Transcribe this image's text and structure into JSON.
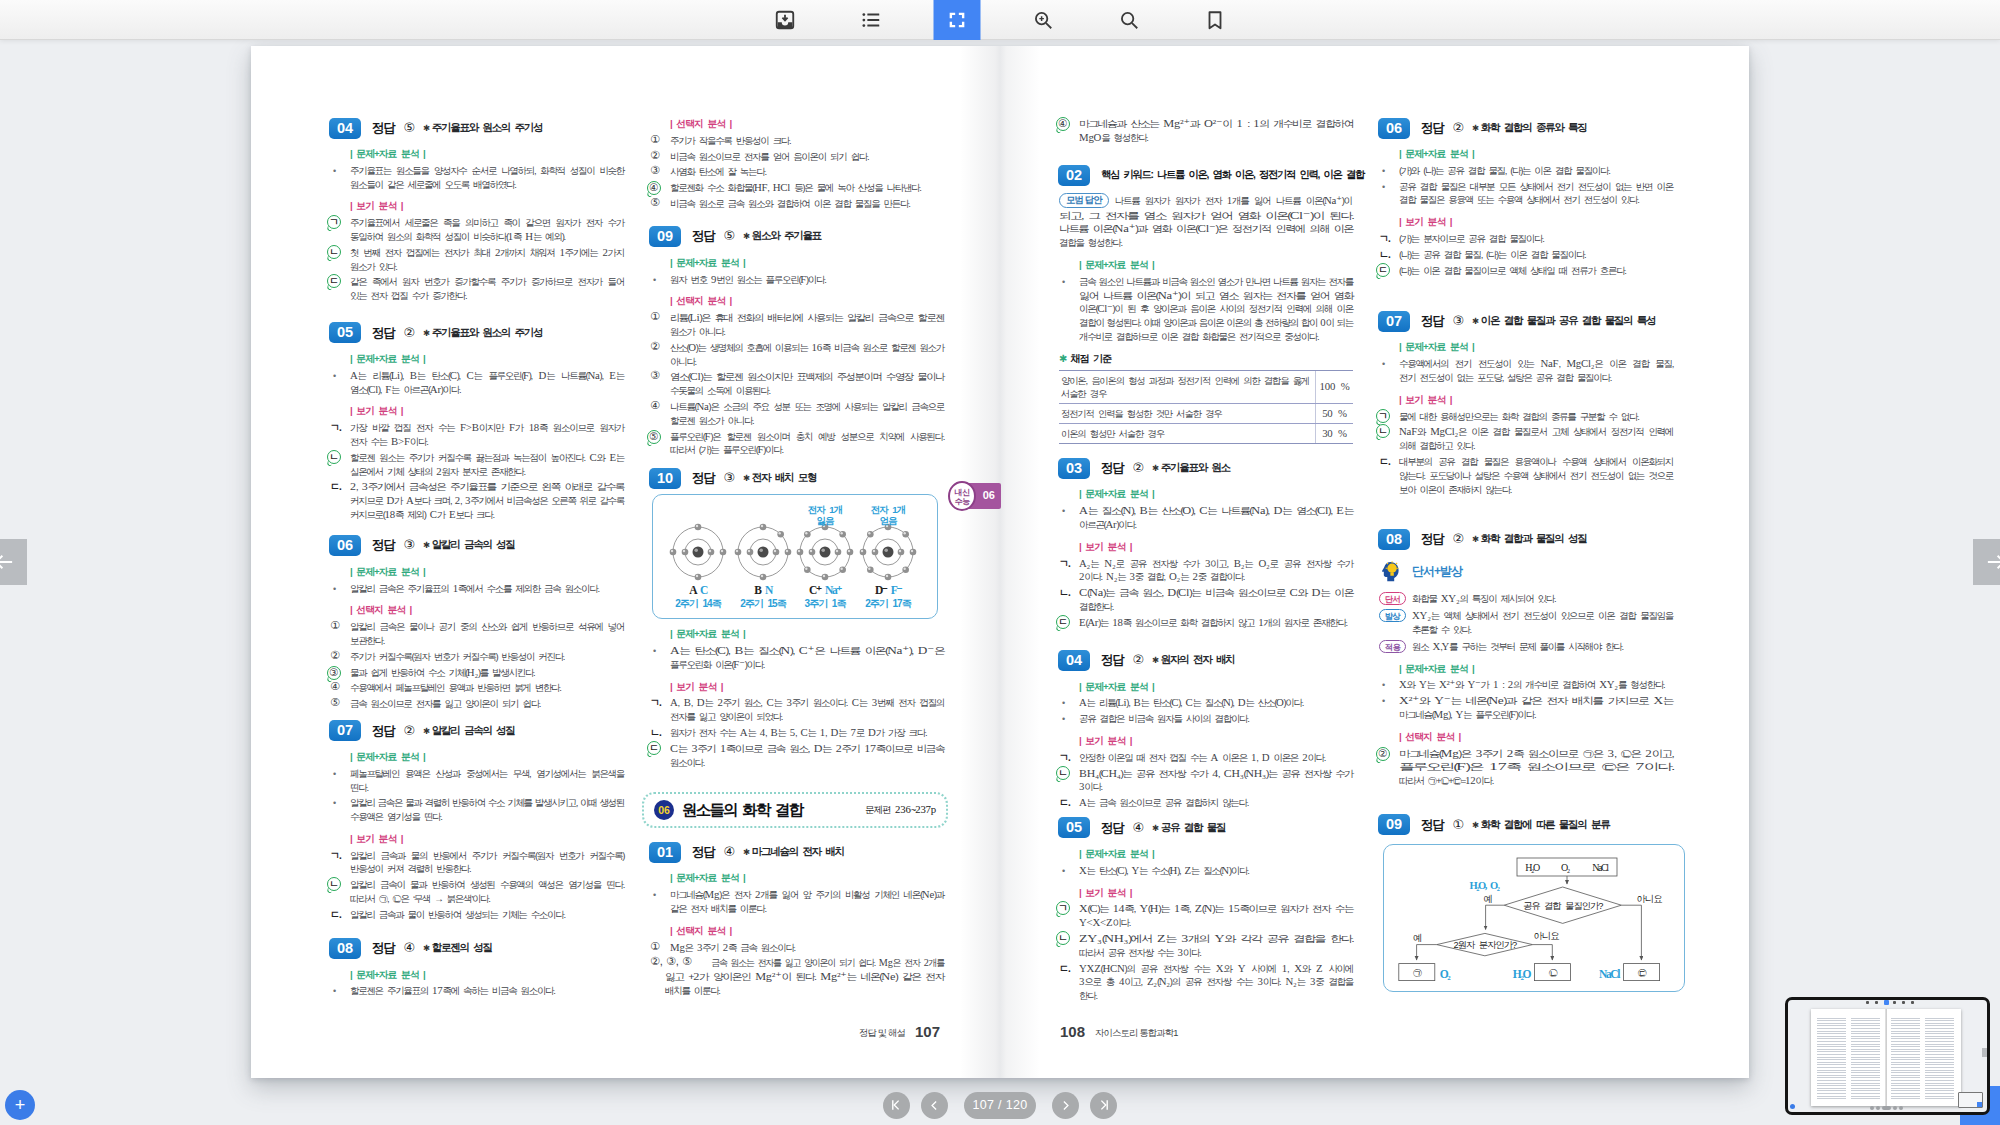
{
  "app": {
    "background": "#eef0f3",
    "accent_blue": "#4285f4",
    "toolbar": {
      "icons": [
        {
          "name": "download-icon",
          "active": false
        },
        {
          "name": "toc-icon",
          "active": false
        },
        {
          "name": "fullscreen-icon",
          "active": true
        },
        {
          "name": "zoom-in-icon",
          "active": false
        },
        {
          "name": "search-icon",
          "active": false
        },
        {
          "name": "bookmark-icon",
          "active": false
        }
      ]
    },
    "side_nav": {
      "prev": "left-arrow",
      "next": "right-arrow"
    },
    "bottom_nav": {
      "first": "|<",
      "prev": "<",
      "page_indicator": "107 / 120",
      "next": ">",
      "last": ">|"
    },
    "fab_plus": "+"
  },
  "labels": {
    "data_analysis": "| 문제+자료 분석 |",
    "choice_analysis": "| 선택지 분석 |",
    "bogi_analysis": "| 보기 분석 |",
    "answer_word": "정답"
  },
  "colors": {
    "badge_blue": "#1e7dd0",
    "green": "#2fa97c",
    "pink": "#d23f7e",
    "answer_green": "#27a858",
    "purple": "#a4549e",
    "light_blue": "#3eabdc",
    "formula_blue": "#2b9fd8"
  },
  "page_left": {
    "footer_label": "정답 및 해설",
    "footer_page": "107",
    "columns": [
      [
        {
          "t": "q",
          "num": "04",
          "ans": "⑤",
          "topic": "주기율표와 원소의 주기성"
        },
        {
          "t": "lbl",
          "k": "green",
          "text": "| 문제+자료 분석 |"
        },
        {
          "t": "p",
          "m": "dot",
          "text": "주기율표는 원소들을 양성자수 순서로 나열하되, 화학적 성질이 비슷한\n원소들이 같은 세로줄에 오도록 배열하였다."
        },
        {
          "t": "lbl",
          "k": "pink",
          "text": "| 보기 분석 |"
        },
        {
          "t": "p",
          "m": "gc:ㄱ",
          "text": "주기율표에서 세로줄은 족을 의미하고 족이 같으면 원자가 전자 수가\n동일하여 원소의 화학적 성질이 비슷하다(1족 H는 예외)."
        },
        {
          "t": "p",
          "m": "gc:ㄴ",
          "text": "첫 번째 전자 껍질에는 전자가 최대 2개까지 채워져 1주기에는 2가지\n원소가 있다."
        },
        {
          "t": "p",
          "m": "gc:ㄷ",
          "text": "같은 족에서 원자 번호가 증가할수록 주기가 증가하므로 전자가 들어\n있는 전자 껍질 수가 증가한다."
        },
        {
          "t": "q",
          "num": "05",
          "ans": "②",
          "topic": "주기율표와 원소의 주기성",
          "mt": 19
        },
        {
          "t": "lbl",
          "k": "green",
          "text": "| 문제+자료 분석 |"
        },
        {
          "t": "p",
          "m": "dot",
          "text": "A는 리튬(Li), B는 탄소(C), C는 플루오린(F), D는 나트륨(Na), E는\n염소(Cl), F는 아르곤(Ar)이다."
        },
        {
          "t": "lbl",
          "k": "pink",
          "text": "| 보기 분석 |"
        },
        {
          "t": "p",
          "m": "lt:ㄱ",
          "text": "가장 바깥 껍질 전자 수는 F>B이지만 F가 18족 원소이므로 원자가\n전자 수는 B>F이다."
        },
        {
          "t": "p",
          "m": "gc:ㄴ",
          "text": "할로젠 원소는 주기가 커질수록 끓는점과 녹는점이 높아진다. C와 E는\n실온에서 기체 상태의 2원자 분자로 존재한다."
        },
        {
          "t": "p",
          "m": "lt:ㄷ",
          "text": "2, 3주기에서 금속성은 주기율표를 기준으로 왼쪽 아래로 갈수록\n커지므로 D가 A보다 크며, 2, 3주기에서 비금속성은 오른쪽 위로 갈수록\n커지므로(18족 제외) C가 E보다 크다."
        },
        {
          "t": "q",
          "num": "06",
          "ans": "③",
          "topic": "알칼리 금속의 성질",
          "mt": 13
        },
        {
          "t": "lbl",
          "k": "green",
          "text": "| 문제+자료 분석 |"
        },
        {
          "t": "p",
          "m": "dot",
          "text": "알칼리 금속은 주기율표의 1족에서 수소를 제외한 금속 원소이다."
        },
        {
          "t": "lbl",
          "k": "pink",
          "text": "| 선택지 분석 |"
        },
        {
          "t": "p",
          "m": "n:①",
          "text": "알칼리 금속은 물이나 공기 중의 산소와 쉽게 반응하므로 석유에 넣어\n보관한다."
        },
        {
          "t": "p",
          "m": "n:②",
          "text": "주기가 커질수록(원자 번호가 커질수록) 반응성이 커진다."
        },
        {
          "t": "p",
          "m": "gn:③",
          "text": "물과 쉽게 반응하여 수소 기체(H₂)를 발생시킨다."
        },
        {
          "t": "p",
          "m": "n:④",
          "text": "수용액에서 페놀프탈레인 용액과 반응하면 붉게 변한다."
        },
        {
          "t": "p",
          "m": "n:⑤",
          "text": "금속 원소이므로 전자를 잃고 양이온이 되기 쉽다."
        },
        {
          "t": "q",
          "num": "07",
          "ans": "②",
          "topic": "알칼리 금속의 성질",
          "mt": 9
        },
        {
          "t": "lbl",
          "k": "green",
          "text": "| 문제+자료 분석 |"
        },
        {
          "t": "p",
          "m": "dot",
          "text": "페놀프탈레인 용액은 산성과 중성에서는 무색, 염기성에서는 붉은색을\n띤다."
        },
        {
          "t": "p",
          "m": "dot",
          "text": "알칼리 금속은 물과 격렬히 반응하여 수소 기체를 발생시키고, 이때 생성된\n수용액은 염기성을 띤다."
        },
        {
          "t": "lbl",
          "k": "pink",
          "text": "| 보기 분석 |"
        },
        {
          "t": "p",
          "m": "lt:ㄱ",
          "text": "알칼리 금속과 물의 반응에서 주기가 커질수록(원자 번호가 커질수록)\n반응성이 커져 격렬히 반응한다."
        },
        {
          "t": "p",
          "m": "gc:ㄴ",
          "text": "알칼리 금속이 물과 반응하여 생성된 수용액의 액성은 염기성을 띤다.\n따라서 ㉠, ㉡은 ‘무색 → 붉은색’이다."
        },
        {
          "t": "p",
          "m": "lt:ㄷ",
          "text": "알칼리 금속과 물이 반응하여 생성되는 기체는 수소이다."
        },
        {
          "t": "q",
          "num": "08",
          "ans": "④",
          "topic": "할로젠의 성질",
          "mt": 16
        },
        {
          "t": "lbl",
          "k": "green",
          "text": "| 문제+자료 분석 |"
        },
        {
          "t": "p",
          "m": "dot",
          "text": "할로젠은 주기율표의 17족에 속하는 비금속 원소이다."
        }
      ],
      [
        {
          "t": "lbl",
          "k": "pink",
          "text": "| 선택지 분석 |",
          "first": true
        },
        {
          "t": "p",
          "m": "n:①",
          "text": "주기가 작을수록 반응성이 크다."
        },
        {
          "t": "p",
          "m": "n:②",
          "text": "비금속 원소이므로 전자를 얻어 음이온이 되기 쉽다."
        },
        {
          "t": "p",
          "m": "n:③",
          "text": "사염화 탄소에 잘 녹는다."
        },
        {
          "t": "p",
          "m": "gn:④",
          "text": "할로젠화 수소 화합물(HF, HCl 등)은 물에 녹아 산성을 나타낸다."
        },
        {
          "t": "p",
          "m": "n:⑤",
          "text": "비금속 원소로 금속 원소와 결합하여 이온 결합 물질을 만든다."
        },
        {
          "t": "q",
          "num": "09",
          "ans": "⑤",
          "topic": "원소와 주기율표"
        },
        {
          "t": "lbl",
          "k": "green",
          "text": "| 문제+자료 분석 |"
        },
        {
          "t": "p",
          "m": "dot",
          "text": "원자 번호 9번인 원소는 플루오린(F)이다."
        },
        {
          "t": "lbl",
          "k": "pink",
          "text": "| 선택지 분석 |"
        },
        {
          "t": "p",
          "m": "n:①",
          "text": "리튬(Li)은 휴대 전화의 배터리에 사용되는 알칼리 금속으로 할로젠\n원소가 아니다."
        },
        {
          "t": "p",
          "m": "n:②",
          "text": "산소(O)는 생명체의 호흡에 이용되는 16족 비금속 원소로 할로젠 원소가\n아니다."
        },
        {
          "t": "p",
          "m": "n:③",
          "text": "염소(Cl)는 할로젠 원소이지만 표백제의 주성분이며 수영장 물이나\n수돗물의 소독에 이용된다."
        },
        {
          "t": "p",
          "m": "n:④",
          "text": "나트륨(Na)은 소금의 주요 성분 또는 조명에 사용되는 알칼리 금속으로\n할로젠 원소가 아니다."
        },
        {
          "t": "p",
          "m": "gn:⑤",
          "text": "플루오린(F)은 할로젠 원소이며 충치 예방 성분으로 치약에 사용된다.\n따라서 (가)는 플루오린(F)이다."
        },
        {
          "t": "q",
          "num": "10",
          "ans": "③",
          "topic": "전자 배치 모형",
          "mt": 10
        },
        {
          "t": "atoms",
          "mt": -3
        },
        {
          "t": "lbl",
          "k": "green",
          "text": "| 문제+자료 분석 |"
        },
        {
          "t": "p",
          "m": "dot",
          "text": "A는 탄소(C), B는 질소(N), C⁺은 나트륨 이온(Na⁺), D⁻은\n플루오린화 이온(F⁻)이다."
        },
        {
          "t": "lbl",
          "k": "pink",
          "text": "| 보기 분석 |"
        },
        {
          "t": "p",
          "m": "lt:ㄱ",
          "text": "A, B, D는 2주기 원소, C는 3주기 원소이다. C는 3번째 전자 껍질의\n전자를 잃고 양이온이 되었다."
        },
        {
          "t": "p",
          "m": "lt:ㄴ",
          "text": "원자가 전자 수는 A는 4, B는 5, C는 1, D는 7로 D가 가장 크다."
        },
        {
          "t": "p",
          "m": "gc:ㄷ",
          "text": "C는 3주기 1족이므로 금속 원소, D는 2주기 17족이므로 비금속\n원소이다."
        },
        {
          "t": "section",
          "num": "06",
          "title": "원소들의 화학 결합",
          "ref": "문제편 236~237p",
          "mt": 23
        },
        {
          "t": "q",
          "num": "01",
          "ans": "④",
          "topic": "마그네슘의 전자 배치",
          "mt": 13
        },
        {
          "t": "lbl",
          "k": "green",
          "text": "| 문제+자료 분석 |"
        },
        {
          "t": "p",
          "m": "dot",
          "text": "마그네슘(Mg)은 전자 2개를 잃어 앞 주기의 비활성 기체인 네온(Ne)과\n같은 전자 배치를 이룬다."
        },
        {
          "t": "lbl",
          "k": "pink",
          "text": "| 선택지 분석 |"
        },
        {
          "t": "p",
          "m": "n:①",
          "text": "Mg은 3주기 2족 금속 원소이다."
        },
        {
          "t": "p",
          "m": "n:②③⑤",
          "text": "금속 원소는 전자를 잃고 양이온이 되기 쉽다. Mg은 전자 2개를\n잃고 +2가 양이온인 Mg²⁺이 된다. Mg²⁺는 네온(Ne) 같은 전자\n배치를 이룬다."
        }
      ]
    ]
  },
  "page_right": {
    "footer_page": "108",
    "footer_label": "자이스토리 통합과학1",
    "columns": [
      [
        {
          "t": "p",
          "m": "gn:④",
          "first": true,
          "text": "마그네슘과 산소는 Mg²⁺과 O²⁻이 1 : 1의 개수비로 결합하여\nMgO을 형성한다."
        },
        {
          "t": "kw",
          "num": "02",
          "text": "핵심 키워드: 나트륨 이온, 염화 이온, 정전기적 인력, 이온 결합",
          "mt": 20
        },
        {
          "t": "model",
          "label": "모범 답안",
          "text": "나트륨 원자가 원자가 전자 1개를 잃어 나트륨 이온(Na⁺)이\n되고, 그 전자를 염소 원자가 얻어 염화 이온(Cl⁻)이 된다.\n나트륨 이온(Na⁺)과 염화 이온(Cl⁻)은 정전기적 인력에 의해 이온\n결합을 형성한다."
        },
        {
          "t": "lbl",
          "k": "green",
          "text": "| 문제+자료 분석 |"
        },
        {
          "t": "p",
          "m": "dot",
          "text": "금속 원소인 나트륨과 비금속 원소인 염소가 만나면 나트륨 원자는 전자를\n잃어 나트륨 이온(Na⁺)이 되고 염소 원자는 전자를 얻어 염화\n이온(Cl⁻)이 된 후 양이온과 음이온 사이의 정전기적 인력에 의해 이온\n결합이 형성된다. 이때 양이온과 음이온 이온의 총 전하량의 합이 0이 되는\n개수비로 결합하므로 이온 결합 화합물은 전기적으로 중성이다."
        },
        {
          "t": "grade_hdr",
          "text": "채점 기준"
        },
        {
          "t": "table",
          "rows": [
            [
              "양이온, 음이온의 형성 과정과 정전기적 인력에 의한 결합을 옳게\n서술한 경우",
              "100 %"
            ],
            [
              "정전기적 인력을 형성한 것만 서술한 경우",
              "50 %"
            ],
            [
              "이온의 형성만 서술한 경우",
              "30 %"
            ]
          ]
        },
        {
          "t": "q",
          "num": "03",
          "ans": "②",
          "topic": "주기율표와 원소",
          "mt": 13
        },
        {
          "t": "lbl",
          "k": "green",
          "text": "| 문제+자료 분석 |"
        },
        {
          "t": "p",
          "m": "dot",
          "text": "A는 질소(N), B는 산소(O), C는 나트륨(Na), D는 염소(Cl), E는\n아르곤(Ar)이다."
        },
        {
          "t": "lbl",
          "k": "pink",
          "text": "| 보기 분석 |"
        },
        {
          "t": "p",
          "m": "lt:ㄱ",
          "text": "A₂는 N₂로 공유 전자쌍 수가 3이고, B₂는 O₂로 공유 전자쌍 수가\n2이다. N₂는 3중 결합, O₂는 2중 결합이다."
        },
        {
          "t": "p",
          "m": "lt:ㄴ",
          "text": "C(Na)는 금속 원소, D(Cl)는 비금속 원소이므로 C와 D는 이온\n결합한다."
        },
        {
          "t": "p",
          "m": "gc:ㄷ",
          "text": "E(Ar)는 18족 원소이므로 화학 결합하지 않고 1개의 원자로 존재한다."
        },
        {
          "t": "q",
          "num": "04",
          "ans": "②",
          "topic": "원자의 전자 배치",
          "mt": 20
        },
        {
          "t": "lbl",
          "k": "green",
          "text": "| 문제+자료 분석 |"
        },
        {
          "t": "p",
          "m": "dot",
          "text": "A는 리튬(Li), B는 탄소(C), C는 질소(N), D는 산소(O)이다."
        },
        {
          "t": "p",
          "m": "dot",
          "text": "공유 결합은 비금속 원자들 사이의 결합이다."
        },
        {
          "t": "lbl",
          "k": "pink",
          "text": "| 보기 분석 |"
        },
        {
          "t": "p",
          "m": "lt:ㄱ",
          "text": "안정한 이온일 때 전자 껍질 수는 A 이온은 1, D 이온은 2이다."
        },
        {
          "t": "p",
          "m": "gc:ㄴ",
          "text": "BH₄(CH₄)는 공유 전자쌍 수가 4, CH₃(NH₃)는 공유 전자쌍 수가\n3이다."
        },
        {
          "t": "p",
          "m": "lt:ㄷ",
          "text": "A는 금속 원소이므로 공유 결합하지 않는다."
        },
        {
          "t": "q",
          "num": "05",
          "ans": "④",
          "topic": "공유 결합 물질",
          "mt": 7
        },
        {
          "t": "lbl",
          "k": "green",
          "text": "| 문제+자료 분석 |"
        },
        {
          "t": "p",
          "m": "dot",
          "text": "X는 탄소(C), Y는 수소(H), Z는 질소(N)이다."
        },
        {
          "t": "lbl",
          "k": "pink",
          "text": "| 보기 분석 |"
        },
        {
          "t": "p",
          "m": "gc:ㄱ",
          "text": "X(C)는 14족, Y(H)는 1족, Z(N)는 15족이므로 원자가 전자 수는\nY<X<Z이다."
        },
        {
          "t": "p",
          "m": "gc:ㄴ",
          "text": "ZY₃(NH₃)에서 Z는 3개의 Y와 각각 공유 결합을 한다.\n따라서 공유 전자쌍 수는 3이다."
        },
        {
          "t": "p",
          "m": "lt:ㄷ",
          "text": "YXZ(HCN)의 공유 전자쌍 수는 X와 Y 사이에 1, X와 Z 사이에\n3으로 총 4이고, Z₂(N₂)의 공유 전자쌍 수는 3이다. N₂는 3중 결합을\n한다."
        }
      ],
      [
        {
          "t": "q",
          "num": "06",
          "ans": "②",
          "topic": "화학 결합의 종류와 특징",
          "first": true
        },
        {
          "t": "lbl",
          "k": "green",
          "text": "| 문제+자료 분석 |"
        },
        {
          "t": "p",
          "m": "dot",
          "text": "(가)와 (나)는 공유 결합 물질, (다)는 이온 결합 물질이다."
        },
        {
          "t": "p",
          "m": "dot",
          "text": "공유 결합 물질은 대부분 모든 상태에서 전기 전도성이 없는 반면 이온\n결합 물질은 용융액 또는 수용액 상태에서 전기 전도성이 있다."
        },
        {
          "t": "lbl",
          "k": "pink",
          "text": "| 보기 분석 |"
        },
        {
          "t": "p",
          "m": "lt:ㄱ",
          "text": "(가)는 분자이므로 공유 결합 물질이다."
        },
        {
          "t": "p",
          "m": "lt:ㄴ",
          "text": "(나)는 공유 결합 물질, (다)는 이온 결합 물질이다."
        },
        {
          "t": "p",
          "m": "gc:ㄷ",
          "text": "(다)는 이온 결합 물질이므로 액체 상태일 때 전류가 흐른다."
        },
        {
          "t": "q",
          "num": "07",
          "ans": "③",
          "topic": "이온 결합 물질과 공유 결합 물질의 특성",
          "mt": 33
        },
        {
          "t": "lbl",
          "k": "green",
          "text": "| 문제+자료 분석 |"
        },
        {
          "t": "p",
          "m": "dot",
          "text": "수용액에서의 전기 전도성이 있는 NaF, MgCl₂은 이온 결합 물질,\n전기 전도성이 없는 포도당, 설탕은 공유 결합 물질이다."
        },
        {
          "t": "lbl",
          "k": "pink",
          "text": "| 보기 분석 |"
        },
        {
          "t": "p",
          "m": "gc:ㄱ",
          "text": "물에 대한 용해성만으로는 화학 결합의 종류를 구분할 수 없다."
        },
        {
          "t": "p",
          "m": "gc:ㄴ",
          "text": "NaF와 MgCl₂은 이온 결합 물질로서 고체 상태에서 정전기적 인력에\n의해 결합하고 있다."
        },
        {
          "t": "p",
          "m": "lt:ㄷ",
          "text": "대부분의 공유 결합 물질은 용융액이나 수용액 상태에서 이온화되지\n않는다. 포도당이나 설탕은 수용액 상태에서 전기 전도성이 없는 것으로\n보아 이온이 존재하지 않는다."
        },
        {
          "t": "q",
          "num": "08",
          "ans": "②",
          "topic": "화학 결합과 물질의 성질",
          "mt": 32
        },
        {
          "t": "clue_hdr",
          "text": "단서+발상"
        },
        {
          "t": "pill",
          "tag": "단서",
          "color": "pink",
          "text": "화합물 XY₂의 특징이 제시되어 있다."
        },
        {
          "t": "pill",
          "tag": "발상",
          "color": "blue",
          "text": "XY₂는 액체 상태에서 전기 전도성이 있으므로 이온 결합 물질임을\n추론할 수 있다."
        },
        {
          "t": "pill",
          "tag": "적용",
          "color": "purple",
          "text": "원소 X,Y를 구하는 것부터 문제 풀이를 시작해야 한다."
        },
        {
          "t": "lbl",
          "k": "green",
          "text": "| 문제+자료 분석 |"
        },
        {
          "t": "p",
          "m": "dot",
          "text": "X와 Y는 X²⁺와 Y⁻가 1 : 2의 개수비로 결합하여 XY₂를 형성한다."
        },
        {
          "t": "p",
          "m": "dot",
          "text": "X²⁺와 Y⁻는 네온(Ne)과 같은 전자 배치를 가지므로 X는\n마그네슘(Mg), Y는 플루오린(F)이다."
        },
        {
          "t": "lbl",
          "k": "pink",
          "text": "| 선택지 분석 |"
        },
        {
          "t": "p",
          "m": "gn:②",
          "text": "마그네슘(Mg)은 3주기 2족 원소이므로 ㉠은 3, ㉡은 2이고,\n플루오린(F)은 17족 원소이므로 ㉢은 7이다.\n따라서 ㉠+㉡+㉢=12이다."
        },
        {
          "t": "q",
          "num": "09",
          "ans": "①",
          "topic": "화학 결합에 따른 물질의 분류",
          "mt": 26
        },
        {
          "t": "flow",
          "mt": 2
        }
      ]
    ]
  },
  "atoms_figure": {
    "tag_badge": {
      "circle_text": "내신\n수능",
      "num": "06"
    },
    "atoms": [
      {
        "label_letter": "A",
        "label_el": "C",
        "sub": "2주기 14족",
        "outer": 4,
        "note": ""
      },
      {
        "label_letter": "B",
        "label_el": "N",
        "sub": "2주기 15족",
        "outer": 5,
        "note": ""
      },
      {
        "label_letter": "C⁺",
        "label_el": "Na⁺",
        "sub": "3주기 1족",
        "outer": 8,
        "note": "전자 1개\n잃음"
      },
      {
        "label_letter": "D⁻",
        "label_el": "F⁻",
        "sub": "2주기 17족",
        "outer": 8,
        "note": "전자 1개\n얻음"
      }
    ]
  },
  "flow_figure": {
    "source_box": "H₂O    O₂    NaCl",
    "d1": "공유 결합 물질인가?",
    "d2": "2원자 분자인가?",
    "yes": "예",
    "no": "아니요",
    "branch_label": "H₂O, O₂",
    "r1": "㉠",
    "r1_note": "O₂",
    "r2": "㉡",
    "r2_note": "H₂O",
    "r3": "㉢",
    "r3_note": "NaCl"
  },
  "thumbnail": {
    "name": "spread-preview"
  }
}
